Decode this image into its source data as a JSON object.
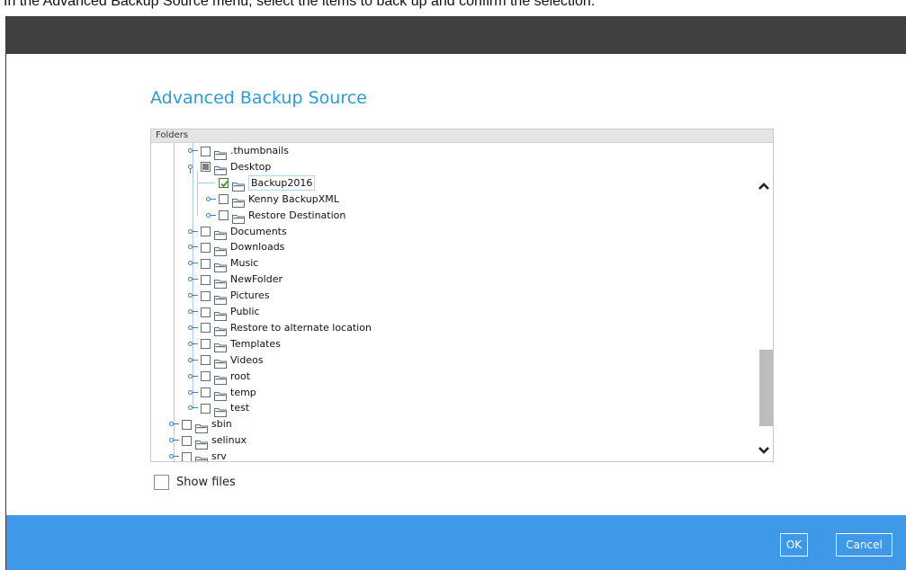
{
  "context_text": "In the Advanced Backup Source menu, select the items to back up and confirm the selection.",
  "dialog": {
    "title": "Advanced Backup Source",
    "tree_header": "Folders",
    "show_files_label": "Show files",
    "ok_label": "OK",
    "cancel_label": "Cancel"
  },
  "tree": {
    "nodes": [
      {
        "label": ".thumbnails",
        "level": 2,
        "state": "unchecked",
        "expanded": false
      },
      {
        "label": "Desktop",
        "level": 2,
        "state": "partial",
        "expanded": true
      },
      {
        "label": "Backup2016",
        "level": 3,
        "state": "checked",
        "expanded": false,
        "leaf": true,
        "selected": true
      },
      {
        "label": "Kenny BackupXML",
        "level": 3,
        "state": "unchecked",
        "expanded": false
      },
      {
        "label": "Restore Destination",
        "level": 3,
        "state": "unchecked",
        "expanded": false
      },
      {
        "label": "Documents",
        "level": 2,
        "state": "unchecked",
        "expanded": false
      },
      {
        "label": "Downloads",
        "level": 2,
        "state": "unchecked",
        "expanded": false
      },
      {
        "label": "Music",
        "level": 2,
        "state": "unchecked",
        "expanded": false
      },
      {
        "label": "NewFolder",
        "level": 2,
        "state": "unchecked",
        "expanded": false
      },
      {
        "label": "Pictures",
        "level": 2,
        "state": "unchecked",
        "expanded": false
      },
      {
        "label": "Public",
        "level": 2,
        "state": "unchecked",
        "expanded": false
      },
      {
        "label": "Restore to alternate location",
        "level": 2,
        "state": "unchecked",
        "expanded": false
      },
      {
        "label": "Templates",
        "level": 2,
        "state": "unchecked",
        "expanded": false
      },
      {
        "label": "Videos",
        "level": 2,
        "state": "unchecked",
        "expanded": false
      },
      {
        "label": "root",
        "level": 2,
        "state": "unchecked",
        "expanded": false
      },
      {
        "label": "temp",
        "level": 2,
        "state": "unchecked",
        "expanded": false
      },
      {
        "label": "test",
        "level": 2,
        "state": "unchecked",
        "expanded": false
      },
      {
        "label": "sbin",
        "level": 1,
        "state": "unchecked",
        "expanded": false
      },
      {
        "label": "selinux",
        "level": 1,
        "state": "unchecked",
        "expanded": false
      },
      {
        "label": "srv",
        "level": 1,
        "state": "unchecked",
        "expanded": false
      }
    ]
  },
  "icons": {
    "folder": "folder-icon",
    "expand": "expand-toggle-icon",
    "scroll_up": "chevron-up-icon",
    "scroll_down": "chevron-down-icon"
  },
  "colors": {
    "title_bar": "#404040",
    "title_text": "#2d9bd8",
    "footer": "#3f99e8",
    "tree_line": "#a9cbe8",
    "check_green": "#3a9b2a"
  }
}
